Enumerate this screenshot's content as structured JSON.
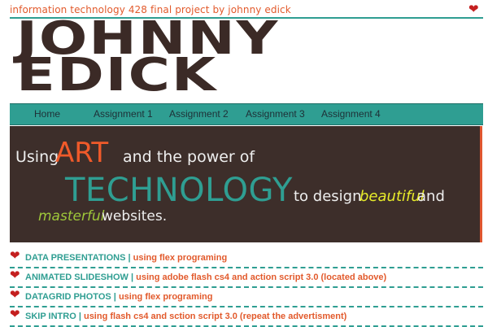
{
  "header": {
    "tagline": "information technology 428 final project by johnny edick",
    "heart_glyph": "❤",
    "logo_line1": "JOHNNY",
    "logo_line2": "EDICK"
  },
  "nav": {
    "items": [
      "Home",
      "Assignment 1",
      "Assignment 2",
      "Assignment 3",
      "Assignment 4"
    ]
  },
  "hero": {
    "using": "Using",
    "art": "ART",
    "and_power": "and the power of",
    "technology": "TECHNOLOGY",
    "to_design": "to design",
    "beautiful": "beautiful",
    "and": "and",
    "masterful": "masterful",
    "websites": "websites."
  },
  "projects": [
    {
      "title": "DATA PRESENTATIONS",
      "sep": " | ",
      "desc": "using flex programing"
    },
    {
      "title": "ANIMATED SLIDESHOW",
      "sep": " | ",
      "desc": "using adobe flash cs4 and action script 3.0 (located above)"
    },
    {
      "title": "DATAGRID PHOTOS",
      "sep": " | ",
      "desc": "using flex programing"
    },
    {
      "title": "SKIP INTRO",
      "sep": " | ",
      "desc": "using flash cs4 and sction script 3.0 (repeat the advertisment)"
    }
  ],
  "colors": {
    "teal": "#2f9e92",
    "orange": "#e25a2c",
    "brown": "#3d2e2a",
    "heart_red": "#c41f1f",
    "yellow": "#e8ec2a",
    "green": "#9ec73a"
  }
}
